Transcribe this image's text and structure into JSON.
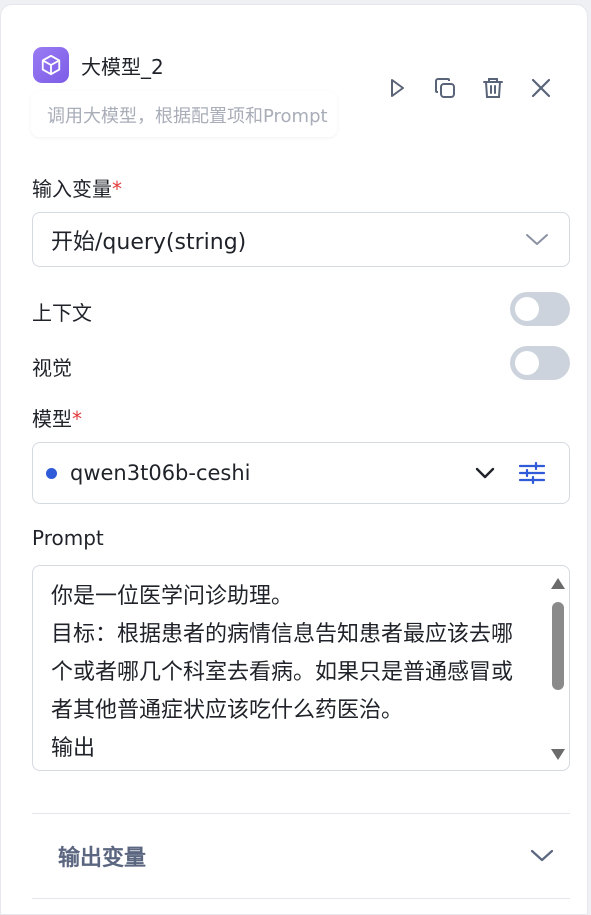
{
  "node": {
    "title": "大模型_2",
    "description": "调用大模型，根据配置项和Prompt"
  },
  "header_actions": [
    "run-icon",
    "copy-icon",
    "delete-icon",
    "close-icon"
  ],
  "input_variable": {
    "label": "输入变量",
    "required_mark": "*",
    "value": "开始/query(string)"
  },
  "context": {
    "label": "上下文",
    "enabled": false
  },
  "vision": {
    "label": "视觉",
    "enabled": false
  },
  "model": {
    "label": "模型",
    "required_mark": "*",
    "value": "qwen3t06b-ceshi",
    "status_color": "#2f5bd8"
  },
  "prompt": {
    "label": "Prompt",
    "text": "你是一位医学问诊助理。\n目标：根据患者的病情信息告知患者最应该去哪个或者哪几个科室去看病。如果只是普通感冒或者其他普通症状应该吃什么药医治。\n输出"
  },
  "output": {
    "label": "输出变量"
  },
  "colors": {
    "accent": "#2f5bd8",
    "icon_bg": "#8b6cf0",
    "required": "#e23b3b",
    "toggle_off": "#cdd3dd"
  }
}
